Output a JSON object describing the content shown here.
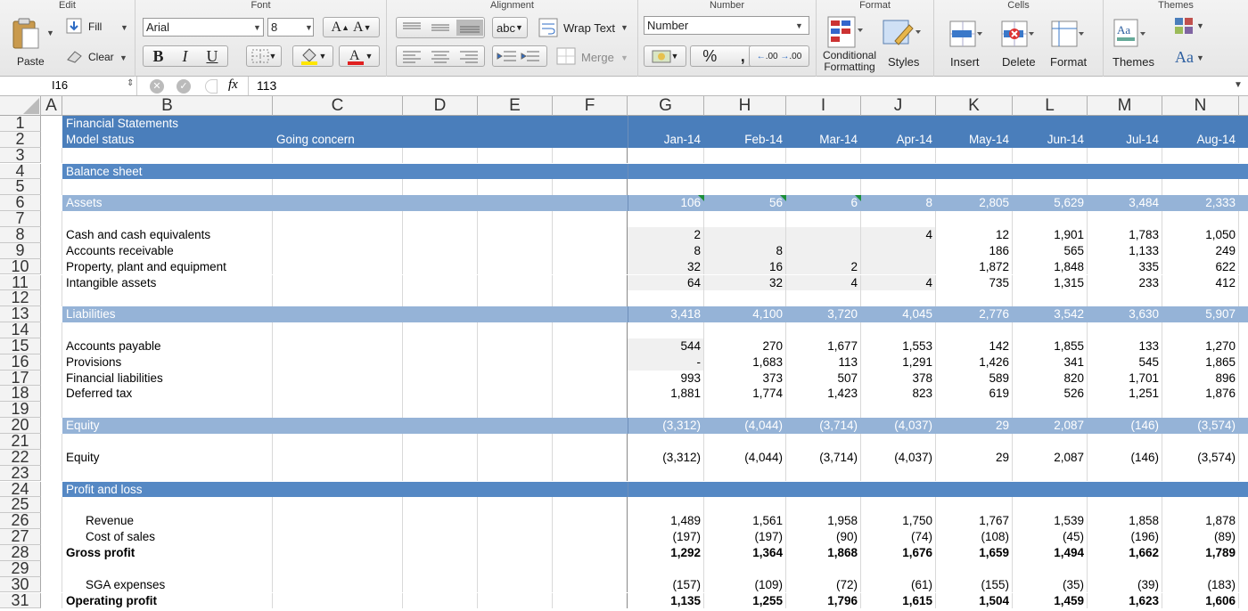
{
  "ribbon": {
    "groups": {
      "edit": "Edit",
      "font": "Font",
      "alignment": "Alignment",
      "number": "Number",
      "format": "Format",
      "cells": "Cells",
      "themes": "Themes"
    },
    "paste": "Paste",
    "fill": "Fill",
    "clear": "Clear",
    "font_name": "Arial",
    "font_size": "8",
    "wrap_text": "Wrap Text",
    "merge": "Merge",
    "abc": "abc",
    "number_format": "Number",
    "percent": "%",
    "comma": ",",
    "conditional_formatting": "Conditional Formatting",
    "styles": "Styles",
    "insert": "Insert",
    "delete": "Delete",
    "format": "Format",
    "themes": "Themes",
    "bold": "B",
    "italic": "I",
    "underline": "U",
    "increase_font": "A",
    "decrease_font": "A",
    "aa": "Aa",
    "aa2": "Aa",
    "inc_dec": ".00",
    "accent": "#4a7ebb"
  },
  "formula_bar": {
    "cell_ref": "I16",
    "fx": "fx",
    "value": "113"
  },
  "columns": [
    "A",
    "B",
    "C",
    "D",
    "E",
    "F",
    "G",
    "H",
    "I",
    "J",
    "K",
    "L",
    "M",
    "N"
  ],
  "months": [
    "Jan-14",
    "Feb-14",
    "Mar-14",
    "Apr-14",
    "May-14",
    "Jun-14",
    "Jul-14",
    "Aug-14"
  ],
  "colors": {
    "header_band": "#4a7ebb",
    "section_band": "#5588c4",
    "sub_band": "#95b3d7",
    "input_fill": "#f0f0f0",
    "triangle": "#1d8f3a"
  },
  "rows": [
    {
      "n": "1",
      "type": "header",
      "b": "Financial Statements",
      "c": "",
      "vals": []
    },
    {
      "n": "2",
      "type": "header",
      "b": "Model status",
      "c": "Going concern",
      "vals": [
        "Jan-14",
        "Feb-14",
        "Mar-14",
        "Apr-14",
        "May-14",
        "Jun-14",
        "Jul-14",
        "Aug-14"
      ]
    },
    {
      "n": "3",
      "type": "blank",
      "b": "",
      "vals": []
    },
    {
      "n": "4",
      "type": "section",
      "b": "Balance sheet",
      "vals": []
    },
    {
      "n": "5",
      "type": "blank",
      "b": "",
      "vals": []
    },
    {
      "n": "6",
      "type": "sub",
      "b": "Assets",
      "vals": [
        "106",
        "56",
        "6",
        "8",
        "2,805",
        "5,629",
        "3,484",
        "2,333"
      ]
    },
    {
      "n": "7",
      "type": "blank",
      "b": "",
      "vals": []
    },
    {
      "n": "8",
      "type": "data",
      "b": "Cash and cash equivalents",
      "vals": [
        "2",
        "",
        "",
        "4",
        "12",
        "1,901",
        "1,783",
        "1,050"
      ]
    },
    {
      "n": "9",
      "type": "data",
      "b": "Accounts receivable",
      "vals": [
        "8",
        "8",
        "",
        "",
        "186",
        "565",
        "1,133",
        "249"
      ]
    },
    {
      "n": "10",
      "type": "data",
      "b": "Property, plant and equipment",
      "vals": [
        "32",
        "16",
        "2",
        "",
        "1,872",
        "1,848",
        "335",
        "622"
      ]
    },
    {
      "n": "11",
      "type": "data",
      "b": "Intangible assets",
      "vals": [
        "64",
        "32",
        "4",
        "4",
        "735",
        "1,315",
        "233",
        "412"
      ]
    },
    {
      "n": "12",
      "type": "blank",
      "b": "",
      "vals": []
    },
    {
      "n": "13",
      "type": "sub",
      "b": "Liabilities",
      "vals": [
        "3,418",
        "4,100",
        "3,720",
        "4,045",
        "2,776",
        "3,542",
        "3,630",
        "5,907"
      ]
    },
    {
      "n": "14",
      "type": "blank",
      "b": "",
      "vals": []
    },
    {
      "n": "15",
      "type": "data",
      "b": "Accounts payable",
      "vals": [
        "544",
        "270",
        "1,677",
        "1,553",
        "142",
        "1,855",
        "133",
        "1,270"
      ]
    },
    {
      "n": "16",
      "type": "data",
      "b": "Provisions",
      "vals": [
        "-",
        "1,683",
        "113",
        "1,291",
        "1,426",
        "341",
        "545",
        "1,865"
      ]
    },
    {
      "n": "17",
      "type": "data",
      "b": "Financial liabilities",
      "vals": [
        "993",
        "373",
        "507",
        "378",
        "589",
        "820",
        "1,701",
        "896"
      ]
    },
    {
      "n": "18",
      "type": "data",
      "b": "Deferred tax",
      "vals": [
        "1,881",
        "1,774",
        "1,423",
        "823",
        "619",
        "526",
        "1,251",
        "1,876"
      ]
    },
    {
      "n": "19",
      "type": "blank",
      "b": "",
      "vals": []
    },
    {
      "n": "20",
      "type": "sub",
      "b": "Equity",
      "vals": [
        "(3,312)",
        "(4,044)",
        "(3,714)",
        "(4,037)",
        "29",
        "2,087",
        "(146)",
        "(3,574)"
      ]
    },
    {
      "n": "21",
      "type": "blank",
      "b": "",
      "vals": []
    },
    {
      "n": "22",
      "type": "data",
      "b": "Equity",
      "vals": [
        "(3,312)",
        "(4,044)",
        "(3,714)",
        "(4,037)",
        "29",
        "2,087",
        "(146)",
        "(3,574)"
      ]
    },
    {
      "n": "23",
      "type": "blank",
      "b": "",
      "vals": []
    },
    {
      "n": "24",
      "type": "section",
      "b": "Profit and loss",
      "vals": []
    },
    {
      "n": "25",
      "type": "blank",
      "b": "",
      "vals": []
    },
    {
      "n": "26",
      "type": "indent",
      "b": "Revenue",
      "vals": [
        "1,489",
        "1,561",
        "1,958",
        "1,750",
        "1,767",
        "1,539",
        "1,858",
        "1,878"
      ]
    },
    {
      "n": "27",
      "type": "indent",
      "b": "Cost of sales",
      "vals": [
        "(197)",
        "(197)",
        "(90)",
        "(74)",
        "(108)",
        "(45)",
        "(196)",
        "(89)"
      ]
    },
    {
      "n": "28",
      "type": "bold",
      "b": "Gross profit",
      "vals": [
        "1,292",
        "1,364",
        "1,868",
        "1,676",
        "1,659",
        "1,494",
        "1,662",
        "1,789"
      ]
    },
    {
      "n": "29",
      "type": "blank",
      "b": "",
      "vals": []
    },
    {
      "n": "30",
      "type": "indent",
      "b": "SGA expenses",
      "vals": [
        "(157)",
        "(109)",
        "(72)",
        "(61)",
        "(155)",
        "(35)",
        "(39)",
        "(183)"
      ]
    },
    {
      "n": "31",
      "type": "bold",
      "b": "Operating profit",
      "vals": [
        "1,135",
        "1,255",
        "1,796",
        "1,615",
        "1,504",
        "1,459",
        "1,623",
        "1,606"
      ]
    }
  ]
}
